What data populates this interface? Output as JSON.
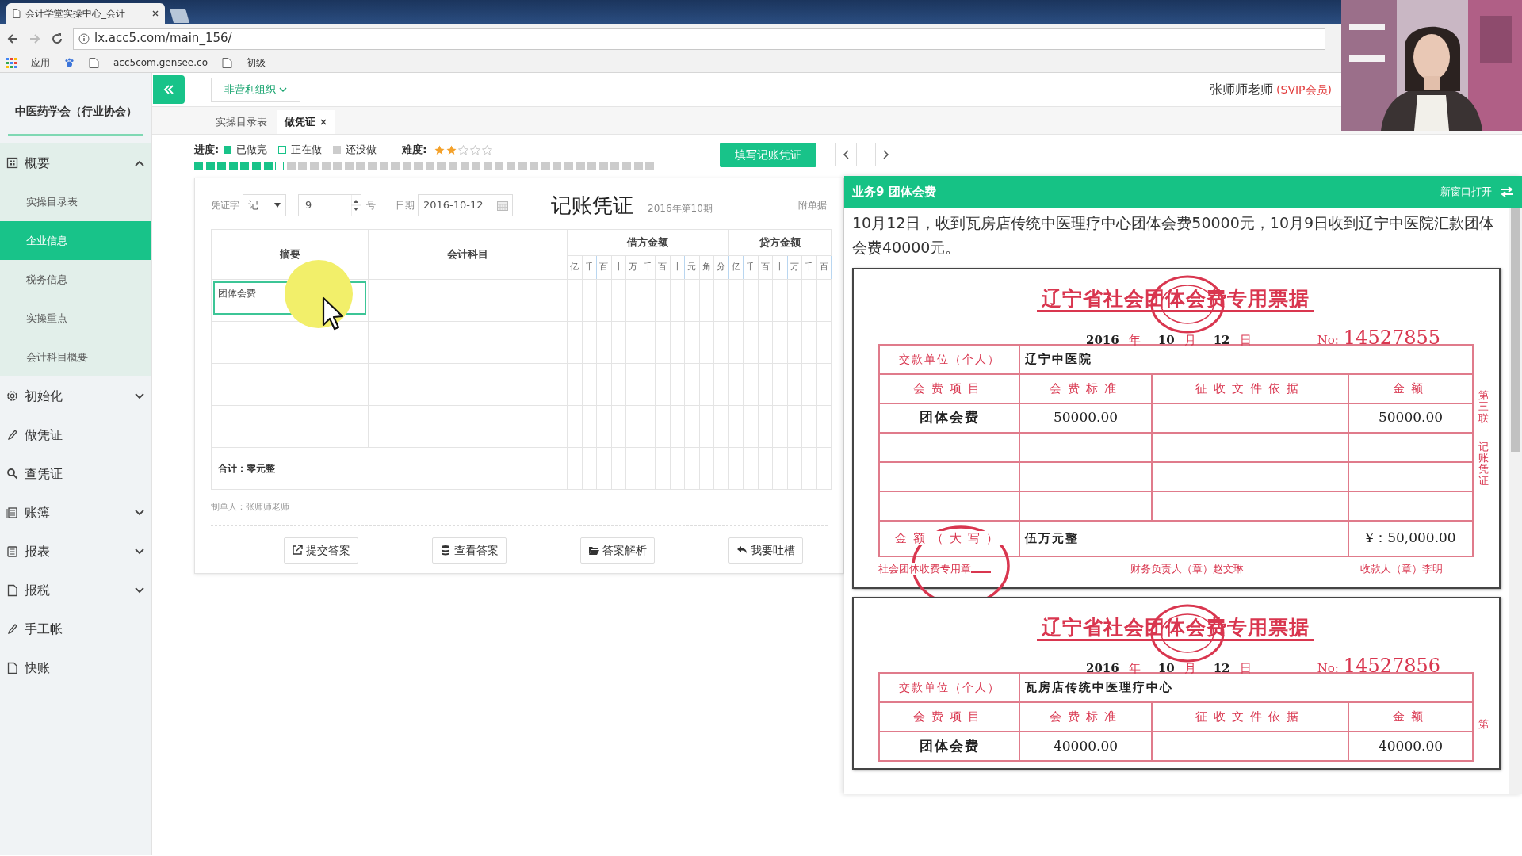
{
  "browser": {
    "tab_title": "会计学堂实操中心_会计",
    "url": "lx.acc5.com/main_156/",
    "bookmarks": [
      "应用",
      "acc5com.gensee.co",
      "初级"
    ]
  },
  "sidebar": {
    "org": "中医药学会（行业协会）",
    "items": [
      {
        "label": "概要",
        "expanded": true,
        "children": [
          {
            "label": "实操目录表",
            "selected": false
          },
          {
            "label": "企业信息",
            "selected": true
          },
          {
            "label": "税务信息",
            "selected": false
          },
          {
            "label": "实操重点",
            "selected": false
          },
          {
            "label": "会计科目概要",
            "selected": false
          }
        ]
      },
      {
        "label": "初始化",
        "expanded": false
      },
      {
        "label": "做凭证"
      },
      {
        "label": "查凭证"
      },
      {
        "label": "账簿",
        "expanded": false
      },
      {
        "label": "报表",
        "expanded": false
      },
      {
        "label": "报税",
        "expanded": false
      },
      {
        "label": "手工帐"
      },
      {
        "label": "快账"
      }
    ]
  },
  "topbar": {
    "org_type": "非营利组织",
    "user_name": "张师师老师",
    "user_level": "(SVIP会员)"
  },
  "tabs": [
    {
      "label": "实操目录表",
      "selected": false,
      "closable": false
    },
    {
      "label": "做凭证",
      "selected": true,
      "closable": true
    }
  ],
  "progress": {
    "label": "进度:",
    "legend": [
      {
        "kind": "done",
        "label": "已做完"
      },
      {
        "kind": "current",
        "label": "正在做"
      },
      {
        "kind": "todo",
        "label": "还没做"
      }
    ],
    "difficulty_label": "难度:",
    "stars": 2,
    "steps": [
      {
        "kind": "done"
      },
      {
        "kind": "done"
      },
      {
        "kind": "done"
      },
      {
        "kind": "done"
      },
      {
        "kind": "done"
      },
      {
        "kind": "done"
      },
      {
        "kind": "done"
      },
      {
        "kind": "current"
      },
      {
        "kind": "todo"
      },
      {
        "kind": "todo"
      },
      {
        "kind": "todo"
      },
      {
        "kind": "todo"
      },
      {
        "kind": "todo"
      },
      {
        "kind": "todo"
      },
      {
        "kind": "todo"
      },
      {
        "kind": "todo"
      },
      {
        "kind": "todo"
      },
      {
        "kind": "todo"
      },
      {
        "kind": "todo"
      },
      {
        "kind": "todo"
      },
      {
        "kind": "todo"
      },
      {
        "kind": "todo"
      },
      {
        "kind": "todo"
      },
      {
        "kind": "todo"
      },
      {
        "kind": "todo"
      },
      {
        "kind": "todo"
      },
      {
        "kind": "todo"
      },
      {
        "kind": "todo"
      },
      {
        "kind": "todo"
      },
      {
        "kind": "todo"
      },
      {
        "kind": "todo"
      },
      {
        "kind": "todo"
      },
      {
        "kind": "todo"
      },
      {
        "kind": "todo"
      },
      {
        "kind": "todo"
      },
      {
        "kind": "todo"
      },
      {
        "kind": "todo"
      },
      {
        "kind": "todo"
      },
      {
        "kind": "todo"
      },
      {
        "kind": "todo"
      }
    ]
  },
  "fill_button": "填写记账凭证",
  "voucher": {
    "word_label": "凭证字",
    "word": "记",
    "number": "9",
    "number_suffix": "号",
    "date_label": "日期",
    "date": "2016-10-12",
    "title": "记账凭证",
    "period": "2016年第10期",
    "attachments_label": "附单据",
    "columns": [
      "摘要",
      "会计科目"
    ],
    "debit": {
      "label": "借方金额",
      "units": [
        "亿",
        "千",
        "百",
        "十",
        "万",
        "千",
        "百",
        "十",
        "元",
        "角",
        "分"
      ]
    },
    "credit": {
      "label": "贷方金额",
      "units": [
        "亿",
        "千",
        "百",
        "十",
        "万",
        "千",
        "百"
      ]
    },
    "rows": [
      {
        "summary": "团体会费",
        "focused": true
      },
      {
        "focused": false
      },
      {
        "focused": false
      },
      {
        "focused": false
      }
    ],
    "total": "合计：零元整",
    "maker": "制单人：张师师老师",
    "actions": [
      "提交答案",
      "查看答案",
      "答案解析",
      "我要吐槽"
    ]
  },
  "task_panel": {
    "title": "业务9 团体会费",
    "open_new": "新窗口打开",
    "description": "10月12日，收到瓦房店传统中医理疗中心团体会费50000元，10月9日收到辽宁中医院汇款团体会费40000元。",
    "receipts": [
      {
        "title": "辽宁省社会团体会费专用票据",
        "date": [
          {
            "value": "2016",
            "unit": "年"
          },
          {
            "value": "10",
            "unit": "月"
          },
          {
            "value": "12",
            "unit": "日"
          }
        ],
        "no_label": "No:",
        "number": "14527855",
        "payer_label": "交款单位（个人）",
        "payer": "辽宁中医院",
        "columns": [
          "会费项目",
          "会费标准",
          "征收文件依据",
          "金额"
        ],
        "rows": [
          {
            "item": "团体会费",
            "standard": "50000.00",
            "amount": "50000.00"
          }
        ],
        "total_label": "金额（大写）",
        "total_words": "伍万元整",
        "total_amount": "¥：50,000.00",
        "footer": [
          "社会团体收费专用章",
          "财务负责人（章）赵文琳",
          "收款人（章）李明"
        ],
        "side_labels": [
          "第三联",
          "记账凭证"
        ]
      },
      {
        "title": "辽宁省社会团体会费专用票据",
        "date": [
          {
            "value": "2016",
            "unit": "年"
          },
          {
            "value": "10",
            "unit": "月"
          },
          {
            "value": "12",
            "unit": "日"
          }
        ],
        "no_label": "No:",
        "number": "14527856",
        "payer_label": "交款单位（个人）",
        "payer": "瓦房店传统中医理疗中心",
        "columns": [
          "会费项目",
          "会费标准",
          "征收文件依据",
          "金额"
        ],
        "rows": [
          {
            "item": "团体会费",
            "standard": "40000.00",
            "amount": "40000.00"
          }
        ],
        "side_labels": [
          "第"
        ]
      }
    ]
  }
}
